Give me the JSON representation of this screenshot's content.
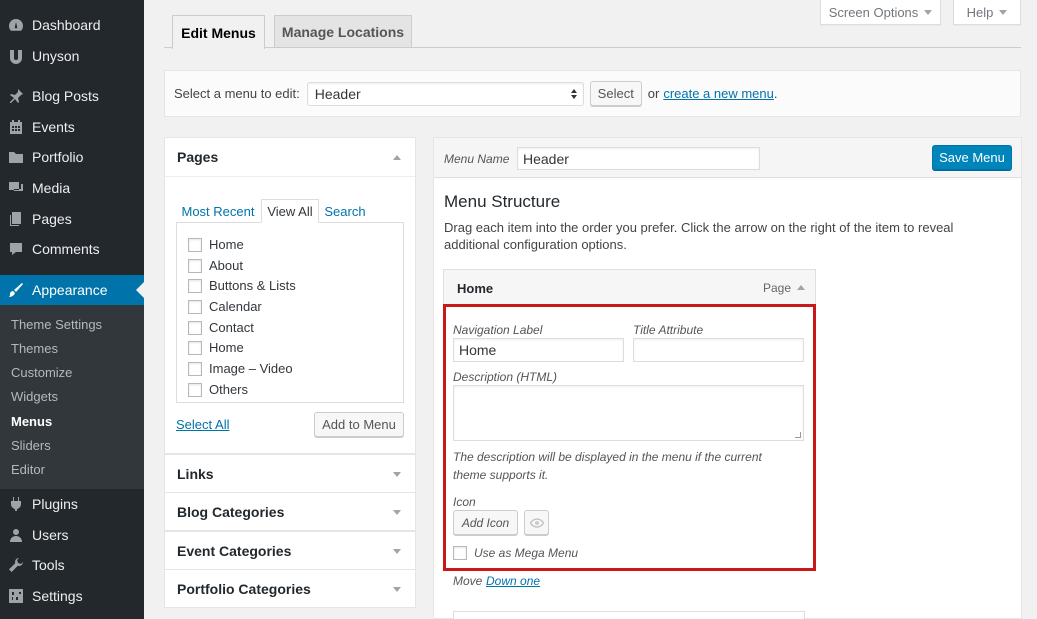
{
  "sidebar": {
    "items": [
      {
        "label": "Dashboard",
        "icon": "dashboard-icon"
      },
      {
        "label": "Unyson",
        "icon": "unyson-icon"
      },
      {
        "label": "Blog Posts",
        "icon": "pin-icon"
      },
      {
        "label": "Events",
        "icon": "calendar-icon"
      },
      {
        "label": "Portfolio",
        "icon": "folder-icon"
      },
      {
        "label": "Media",
        "icon": "media-icon"
      },
      {
        "label": "Pages",
        "icon": "pages-icon"
      },
      {
        "label": "Comments",
        "icon": "comment-icon"
      },
      {
        "label": "Appearance",
        "icon": "brush-icon"
      },
      {
        "label": "Plugins",
        "icon": "plug-icon"
      },
      {
        "label": "Users",
        "icon": "user-icon"
      },
      {
        "label": "Tools",
        "icon": "wrench-icon"
      },
      {
        "label": "Settings",
        "icon": "settings-icon"
      }
    ],
    "submenu": [
      "Theme Settings",
      "Themes",
      "Customize",
      "Widgets",
      "Menus",
      "Sliders",
      "Editor"
    ],
    "active_color": "#0073aa"
  },
  "top": {
    "screen_options": "Screen Options",
    "help": "Help"
  },
  "tabs": {
    "edit": "Edit Menus",
    "locations": "Manage Locations"
  },
  "select_bar": {
    "prompt": "Select a menu to edit:",
    "selected": "Header",
    "select_button": "Select",
    "or": "or",
    "create_link": "create a new menu",
    "period": "."
  },
  "pages_panel": {
    "title": "Pages",
    "tabs": [
      "Most Recent",
      "View All",
      "Search"
    ],
    "items": [
      "Home",
      "About",
      "Buttons & Lists",
      "Calendar",
      "Contact",
      "Home",
      "Image – Video",
      "Others"
    ],
    "select_all": "Select All",
    "add_button": "Add to Menu"
  },
  "accordion": [
    "Links",
    "Blog Categories",
    "Event Categories",
    "Portfolio Categories"
  ],
  "menu": {
    "name_label": "Menu Name",
    "name_value": "Header",
    "save_button": "Save Menu",
    "structure_title": "Menu Structure",
    "instructions": "Drag each item into the order you prefer. Click the arrow on the right of the item to reveal additional configuration options.",
    "item": {
      "title": "Home",
      "type": "Page",
      "nav_label_label": "Navigation Label",
      "nav_label_value": "Home",
      "title_attr_label": "Title Attribute",
      "title_attr_value": "",
      "description_label": "Description (HTML)",
      "description_value": "",
      "description_hint": "The description will be displayed in the menu if the current theme supports it.",
      "icon_label": "Icon",
      "add_icon_button": "Add Icon",
      "mega_menu_label": "Use as Mega Menu",
      "move_label": "Move",
      "down_one": "Down one"
    },
    "highlight_color": "#c81818"
  }
}
